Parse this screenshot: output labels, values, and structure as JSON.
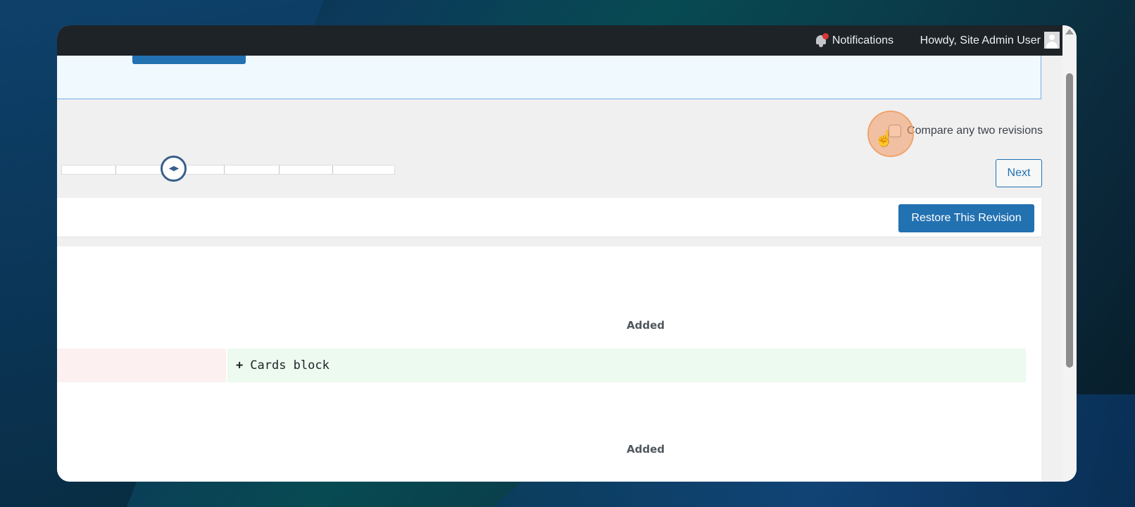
{
  "adminbar": {
    "notifications_label": "Notifications",
    "howdy_label": "Howdy, Site Admin User"
  },
  "revisions": {
    "compare_label": "Compare any two revisions",
    "compare_checked": false,
    "next_label": "Next",
    "restore_label": "Restore This Revision"
  },
  "diff": {
    "rows": [
      {
        "header": "Added",
        "added_text": "Cards block",
        "marker": "+"
      },
      {
        "header": "Added"
      }
    ]
  },
  "colors": {
    "primary": "#2271b1",
    "adminbar_bg": "#1d2327",
    "added_bg": "#edfaef",
    "deleted_bg": "#fcf0f1",
    "cursor_highlight": "#f0a46c"
  }
}
